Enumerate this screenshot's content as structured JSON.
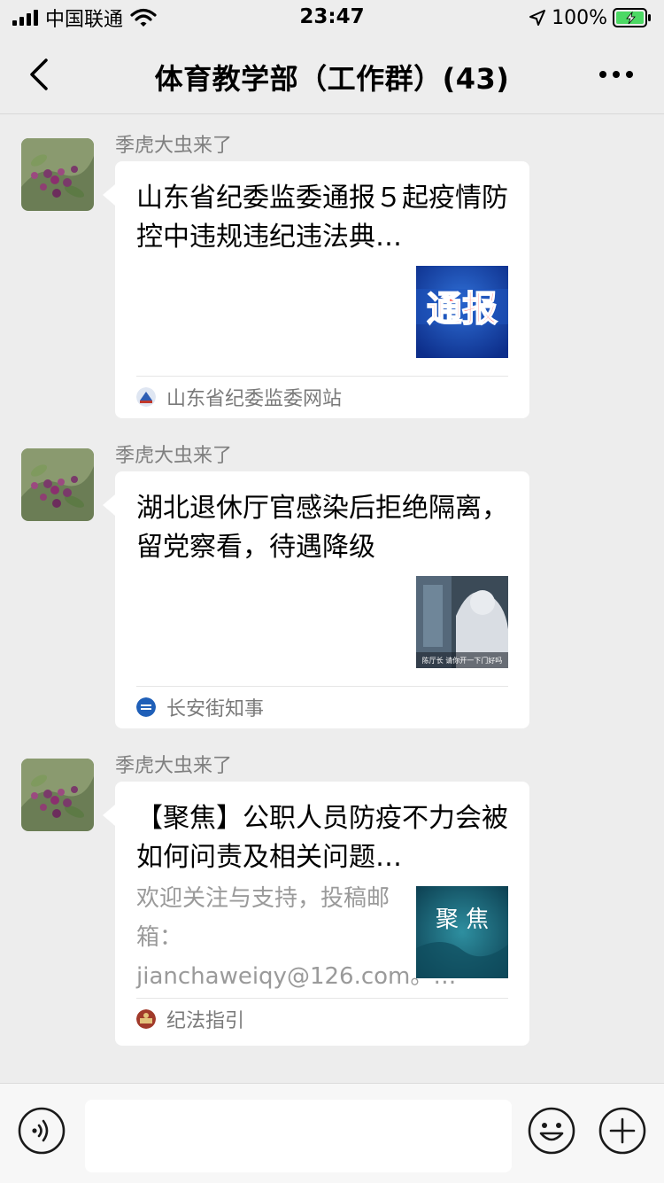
{
  "status_bar": {
    "carrier": "中国联通",
    "time": "23:47",
    "battery_percent": "100%",
    "icons": [
      "signal-icon",
      "wifi-icon",
      "location-icon",
      "battery-icon"
    ]
  },
  "nav": {
    "title": "体育教学部（工作群）(43)"
  },
  "messages": [
    {
      "sender": "季虎大虫来了",
      "title": "山东省纪委监委通报５起疫情防控中违规违纪违法典…",
      "description": "",
      "thumb_text": "通报",
      "source": "山东省纪委监委网站"
    },
    {
      "sender": "季虎大虫来了",
      "title": "湖北退休厅官感染后拒绝隔离，留党察看，待遇降级",
      "description": "",
      "thumb_text": "陈厅长 请你开一下门好吗",
      "source": "长安街知事"
    },
    {
      "sender": "季虎大虫来了",
      "title": "【聚焦】公职人员防疫不力会被如何问责及相关问题…",
      "description": "欢迎关注与支持，投稿邮箱：jianchaweiqy@126.com。…",
      "thumb_text": "聚 焦",
      "source": "纪法指引"
    }
  ],
  "input_bar": {
    "placeholder": "",
    "icons": [
      "voice-icon",
      "emoji-icon",
      "plus-icon"
    ]
  },
  "colors": {
    "background": "#ededed",
    "card": "#ffffff",
    "sender_text": "#7f7f7f",
    "battery_green": "#4cd964"
  }
}
